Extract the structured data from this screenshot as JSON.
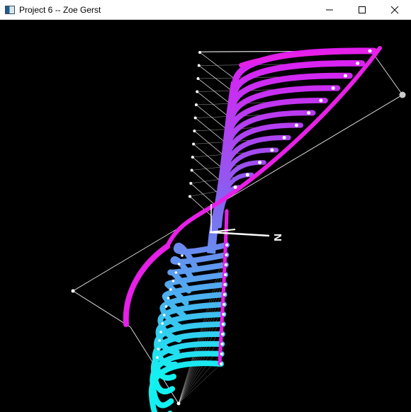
{
  "window": {
    "title": "Project 6 -- Zoe Gerst",
    "icon": "app-window-icon",
    "controls": {
      "minimize": "minimize-icon",
      "maximize": "maximize-icon",
      "close": "close-icon"
    }
  },
  "scene": {
    "axis_label": "N",
    "colors": {
      "background": "#000000",
      "surface_top": "#e21cf2",
      "surface_bottom": "#14f0f0",
      "rim": "#e620e6",
      "control_lines": "#ffffff"
    }
  }
}
